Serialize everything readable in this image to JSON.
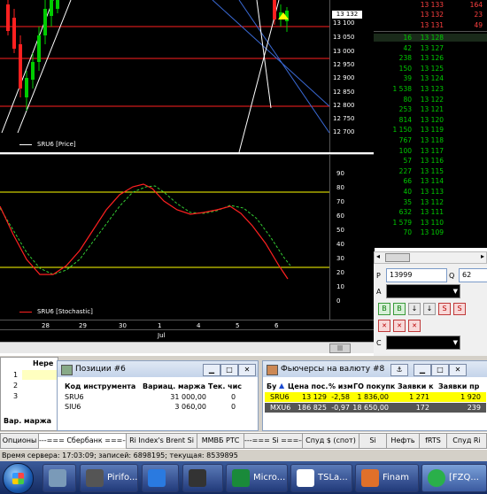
{
  "price_chart": {
    "legend": "SRU6 [Price]",
    "y_ticks": [
      "13 100",
      "13 050",
      "13 000",
      "12 950",
      "12 900",
      "12 850",
      "12 800",
      "12 750",
      "12 700"
    ],
    "markers": [
      {
        "label": "13 132",
        "highlight": true
      }
    ]
  },
  "stoch_chart": {
    "legend": "SRU6 [Stochastic]",
    "y_ticks": [
      "90",
      "80",
      "70",
      "60",
      "50",
      "40",
      "30",
      "20",
      "10",
      "0"
    ]
  },
  "time_axis": {
    "labels": [
      "28",
      "29",
      "30",
      "1",
      "4",
      "5",
      "6"
    ],
    "month": "Jul"
  },
  "order_book": {
    "sell_top": [
      {
        "price": "13 133",
        "size": "164"
      },
      {
        "price": "13 132",
        "size": "23"
      },
      {
        "price": "13 131",
        "size": "49"
      }
    ],
    "buy": [
      {
        "vol": "16",
        "price": "13 128"
      },
      {
        "vol": "42",
        "price": "13 127"
      },
      {
        "vol": "238",
        "price": "13 126"
      },
      {
        "vol": "150",
        "price": "13 125"
      },
      {
        "vol": "39",
        "price": "13 124"
      },
      {
        "vol": "1 538",
        "price": "13 123"
      },
      {
        "vol": "80",
        "price": "13 122"
      },
      {
        "vol": "253",
        "price": "13 121"
      },
      {
        "vol": "814",
        "price": "13 120"
      },
      {
        "vol": "1 150",
        "price": "13 119"
      },
      {
        "vol": "767",
        "price": "13 118"
      },
      {
        "vol": "100",
        "price": "13 117"
      },
      {
        "vol": "57",
        "price": "13 116"
      },
      {
        "vol": "227",
        "price": "13 115"
      },
      {
        "vol": "66",
        "price": "13 114"
      },
      {
        "vol": "40",
        "price": "13 113"
      },
      {
        "vol": "35",
        "price": "13 112"
      },
      {
        "vol": "632",
        "price": "13 111"
      },
      {
        "vol": "1 579",
        "price": "13 110"
      },
      {
        "vol": "70",
        "price": "13 109"
      }
    ]
  },
  "order_panel": {
    "p_label": "P",
    "p_value": "13999",
    "q_label": "Q",
    "q_value": "62",
    "a_label": "A",
    "c_label": "C",
    "buttons": [
      "B",
      "B",
      "↓",
      "↓",
      "S",
      "S"
    ]
  },
  "left_panel": {
    "header": "Нере",
    "rows": [
      "1",
      "2",
      "3"
    ],
    "footer": "Вар. маржа"
  },
  "positions_window": {
    "title": "Позиции #6",
    "headers": [
      "Код инструмента",
      "Вариац. маржа",
      "Тек. чис"
    ],
    "rows": [
      {
        "code": "SRU6",
        "margin": "31 000,00",
        "qty": "0"
      },
      {
        "code": "SIU6",
        "margin": "3 060,00",
        "qty": "0"
      }
    ]
  },
  "futures_window": {
    "title": "Фьючерсы на валюту #8",
    "headers": [
      "Бу",
      "Цена пос.",
      "% изм",
      "ГО покупк",
      "Заявки к",
      "Заявки пр"
    ],
    "rows": [
      {
        "code": "SRU6",
        "price": "13 129",
        "chg": "-2,58",
        "go": "1 836,00",
        "bids": "1 271",
        "asks": "1 920"
      },
      {
        "code": "MXU6",
        "price": "186 825",
        "chg": "-0,97",
        "go": "18 650,00",
        "bids": "172",
        "asks": "239"
      }
    ]
  },
  "tabs": [
    "Опционы",
    "---=== Сбербанк ===---",
    "Ri Index's Brent Si",
    "ММВБ РТС",
    "---=== Si ===---",
    "Спуд $ (спот)",
    "Si",
    "Нефть",
    "fRTS",
    "Спуд Ri"
  ],
  "active_tab_index": 1,
  "status_bar": "Время сервера: 17:03:09; записей: 6898195; текущая: 8539895",
  "taskbar": {
    "items": [
      "Pirifo...",
      "Micro...",
      "TSLa...",
      "Finam",
      "[FZQ..."
    ]
  },
  "colors": {
    "price_bg": "#000000",
    "up": "#00cc00",
    "down": "#ff2020",
    "stoch_main": "#ff2020",
    "stoch_signal": "#33cc33",
    "level": "#ffff00",
    "dom_green": "#00cc00",
    "dom_red": "#ff4040",
    "highlight_row": "#ffff00"
  }
}
